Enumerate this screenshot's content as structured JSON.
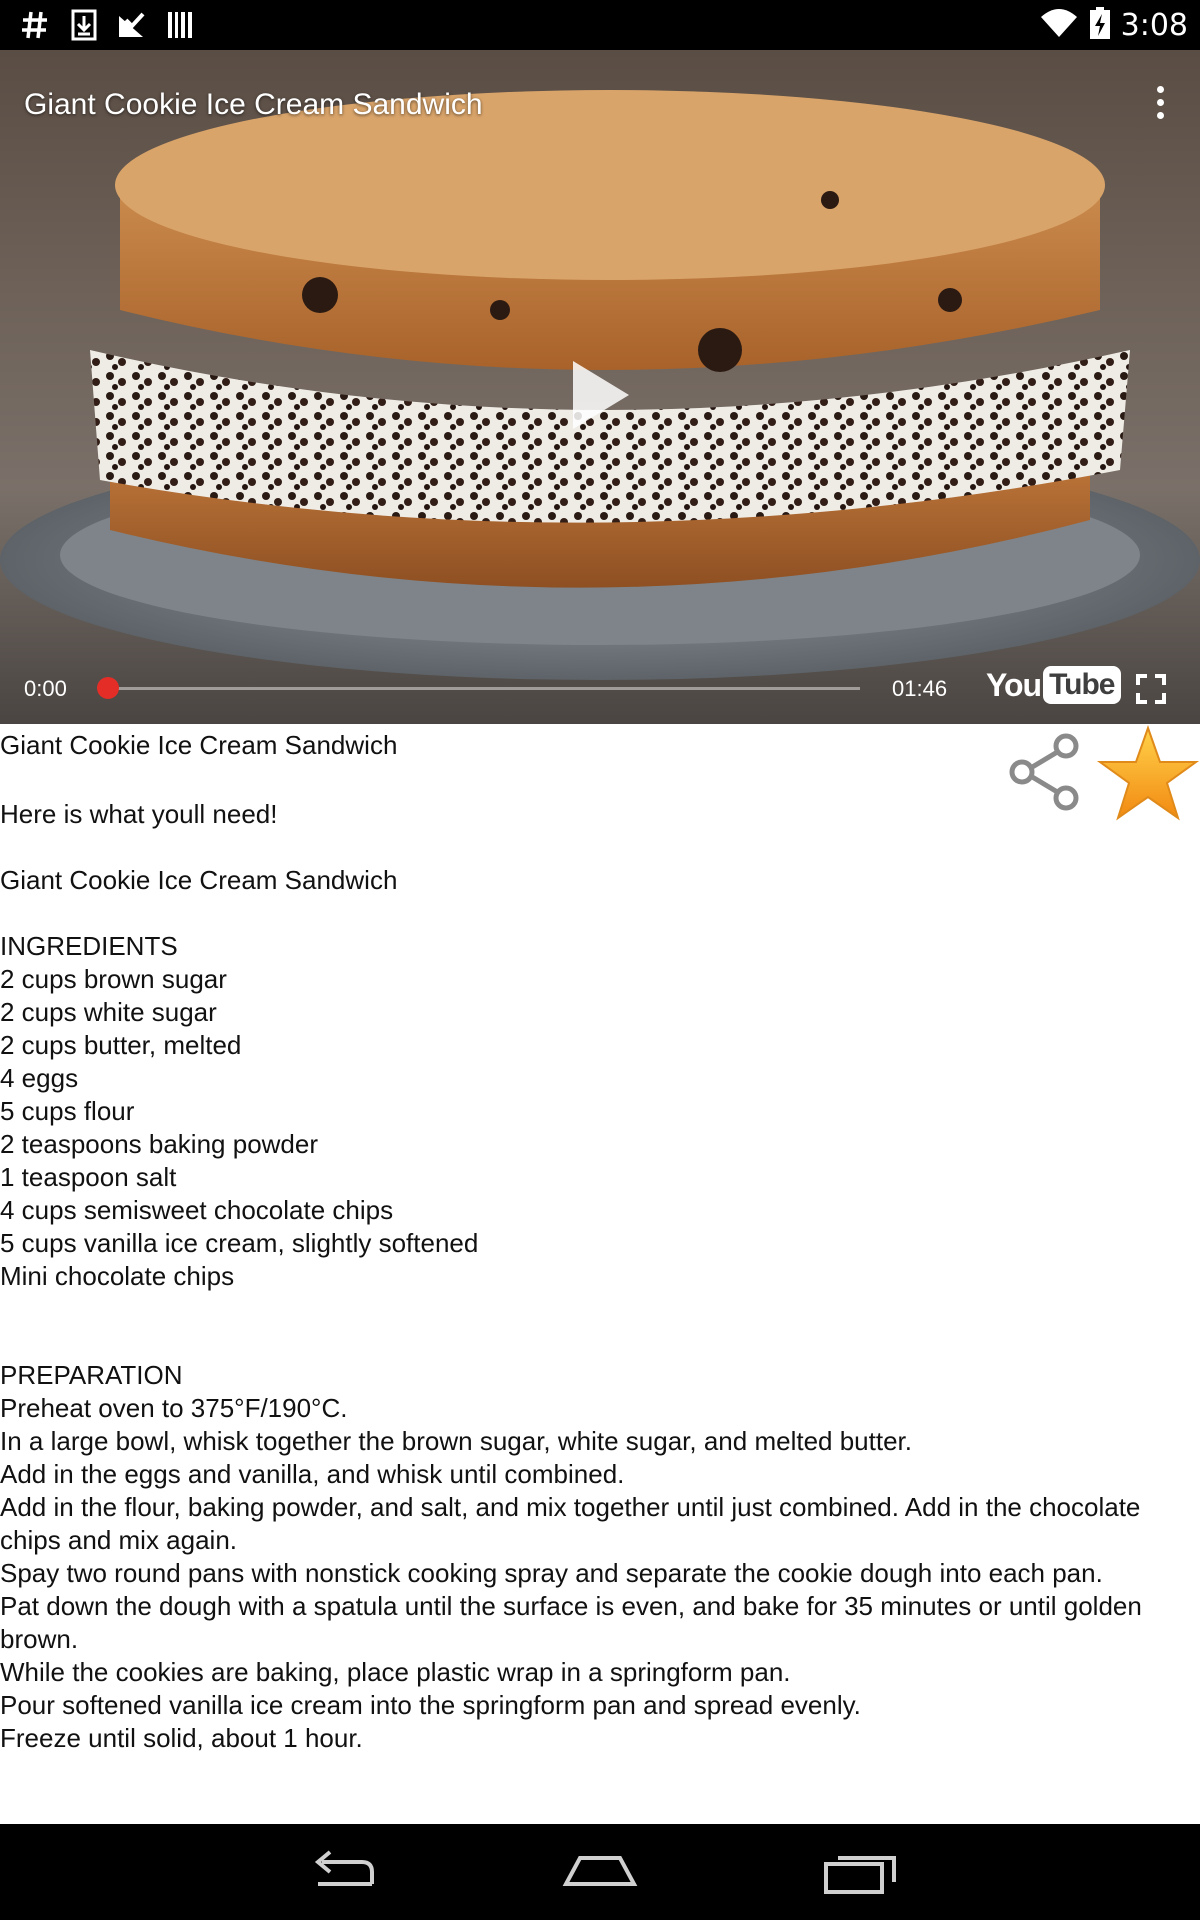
{
  "status_bar": {
    "time": "3:08",
    "notification_icons": [
      "hash-icon",
      "download-icon",
      "inbox-check-icon",
      "barcode-icon"
    ],
    "system_icons": [
      "wifi-icon",
      "battery-charging-icon"
    ]
  },
  "video": {
    "title": "Giant Cookie Ice Cream Sandwich",
    "current_time": "0:00",
    "total_time": "01:46",
    "progress": 0,
    "logo_you": "You",
    "logo_tube": "Tube",
    "accent_color": "#e52d27"
  },
  "recipe": {
    "title": "Giant Cookie Ice Cream Sandwich",
    "intro": "Here is what youll need!",
    "subtitle": "Giant Cookie Ice Cream Sandwich",
    "ingredients_heading": "INGREDIENTS",
    "ingredients": [
      "2 cups brown sugar",
      "2 cups white sugar",
      "2 cups butter, melted",
      "4 eggs",
      "5 cups flour",
      "2 teaspoons baking powder",
      "1 teaspoon salt",
      "4 cups semisweet chocolate chips",
      "5 cups vanilla ice cream, slightly softened",
      "Mini chocolate chips"
    ],
    "preparation_heading": "PREPARATION",
    "preparation": [
      "Preheat oven to 375°F/190°C.",
      "In a large bowl, whisk together the brown sugar, white sugar, and melted butter.",
      "Add in the eggs and vanilla, and whisk until combined.",
      "Add in the flour, baking powder, and salt, and mix together until just combined. Add in the chocolate chips and mix again.",
      "Spay two round pans with nonstick cooking spray and separate the cookie dough into each pan.",
      "Pat down the dough with a spatula until the surface is even, and bake for 35 minutes or until golden brown.",
      "While the cookies are baking, place plastic wrap in a springform pan.",
      "Pour softened vanilla ice cream into the springform pan and spread evenly.",
      "Freeze until solid, about 1 hour."
    ],
    "star_color": "#f6a623"
  },
  "nav_bar": {
    "buttons": [
      "back-icon",
      "home-icon",
      "recents-icon"
    ]
  }
}
